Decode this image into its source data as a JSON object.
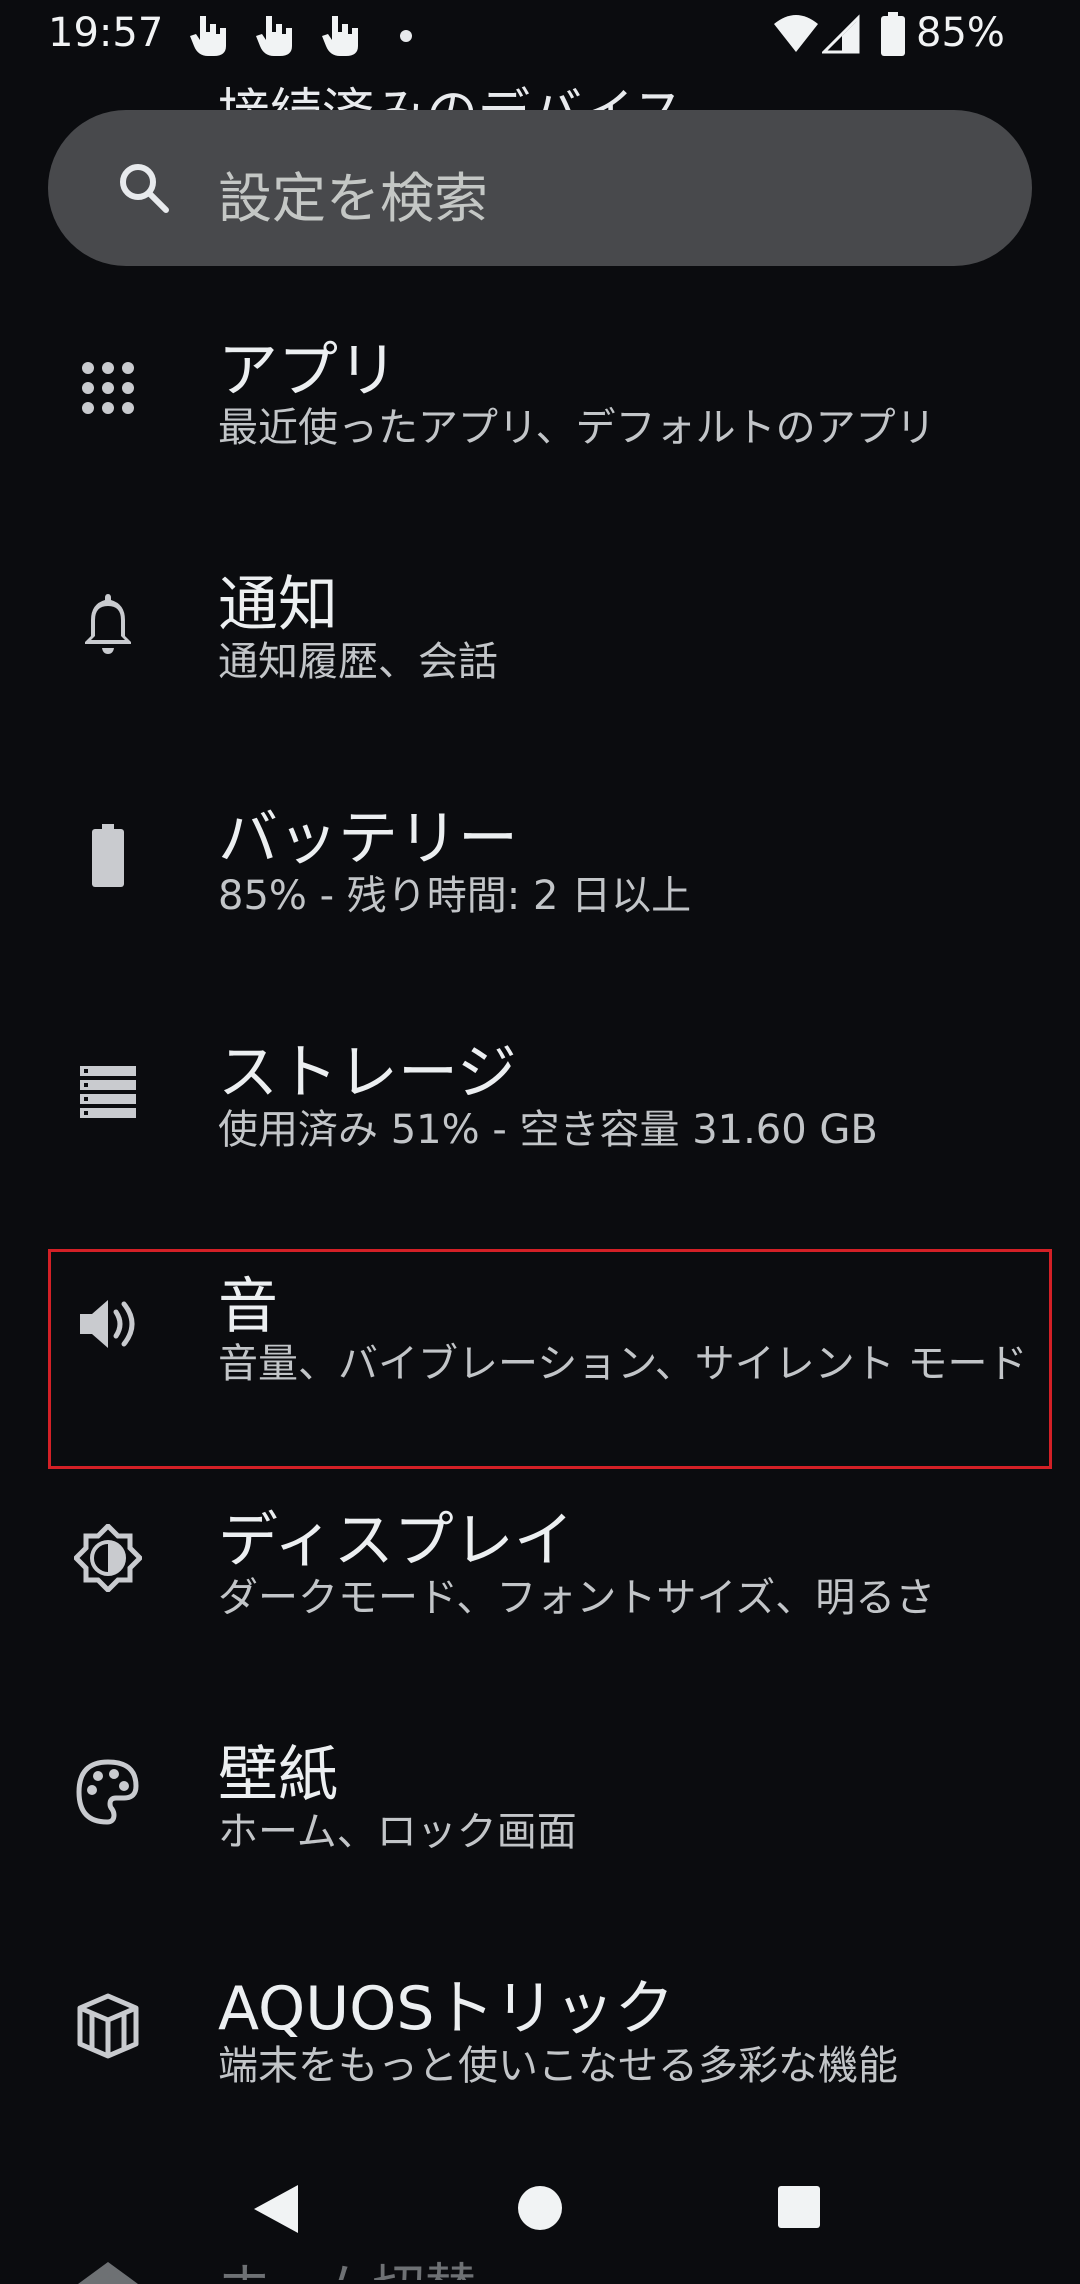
{
  "status_bar": {
    "time": "19:57",
    "battery": "85%",
    "notification_icons": [
      "touch-gesture-icon",
      "touch-gesture-icon",
      "touch-gesture-icon"
    ]
  },
  "scrolled_header": "接続済みのデバイス",
  "search": {
    "placeholder": "設定を検索"
  },
  "items": [
    {
      "icon": "apps-grid-icon",
      "title": "アプリ",
      "summary": "最近使ったアプリ、デフォルトのアプリ"
    },
    {
      "icon": "bell-icon",
      "title": "通知",
      "summary": "通知履歴、会話"
    },
    {
      "icon": "battery-icon",
      "title": "バッテリー",
      "summary": "85% - 残り時間: 2 日以上"
    },
    {
      "icon": "storage-icon",
      "title": "ストレージ",
      "summary": "使用済み 51% - 空き容量 31.60 GB"
    },
    {
      "icon": "speaker-icon",
      "title": "音",
      "summary": "音量、バイブレーション、サイレント モード"
    },
    {
      "icon": "brightness-icon",
      "title": "ディスプレイ",
      "summary": "ダークモード、フォントサイズ、明るさ"
    },
    {
      "icon": "palette-icon",
      "title": "壁紙",
      "summary": "ホーム、ロック画面"
    },
    {
      "icon": "cube-icon",
      "title": "AQUOSトリック",
      "summary": "端末をもっと使いこなせる多彩な機能"
    }
  ],
  "partial_next_item": "ホーム切替",
  "highlight_color": "#d32026"
}
